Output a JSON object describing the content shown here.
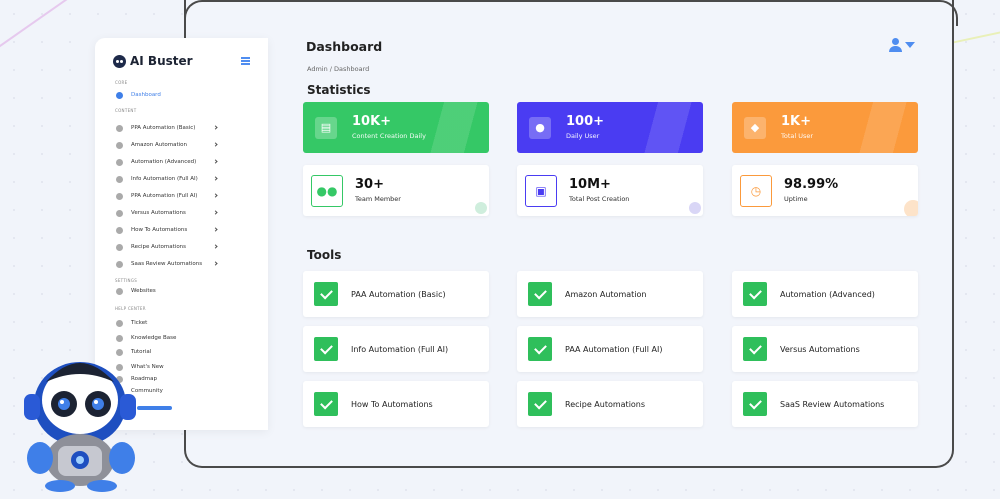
{
  "header": {
    "title": "Dashboard",
    "breadcrumb": "Admin / Dashboard"
  },
  "sidebar": {
    "brand": "AI Buster",
    "sections": {
      "core": "CORE",
      "content": "CONTENT",
      "settings": "SETTINGS",
      "help": "HELP CENTER"
    },
    "core_items": [
      {
        "label": "Dashboard"
      }
    ],
    "content_items": [
      {
        "label": "PPA Automation (Basic)"
      },
      {
        "label": "Amazon Automation"
      },
      {
        "label": "Automation (Advanced)"
      },
      {
        "label": "Info Automation (Full AI)"
      },
      {
        "label": "PPA Automation (Full AI)"
      },
      {
        "label": "Versus Automations"
      },
      {
        "label": "How To Automations"
      },
      {
        "label": "Recipe Automations"
      },
      {
        "label": "Saas Review Automations"
      }
    ],
    "settings_items": [
      {
        "label": "Websites"
      }
    ],
    "help_items": [
      {
        "label": "Ticket"
      },
      {
        "label": "Knowledge Base"
      },
      {
        "label": "Tutorial"
      },
      {
        "label": "What's New"
      },
      {
        "label": "Roadmap"
      },
      {
        "label": "Community"
      }
    ]
  },
  "statistics": {
    "title": "Statistics",
    "cards": [
      {
        "value": "10K+",
        "label": "Content Creation Daily",
        "color": "#35c866"
      },
      {
        "value": "100+",
        "label": "Daily User",
        "color": "#4a3cf2"
      },
      {
        "value": "1K+",
        "label": "Total User",
        "color": "#fb9a3c"
      },
      {
        "value": "30+",
        "label": "Team Member",
        "color": "#35c866"
      },
      {
        "value": "10M+",
        "label": "Total Post Creation",
        "color": "#4a3cf2"
      },
      {
        "value": "98.99%",
        "label": "Uptime",
        "color": "#fb9a3c"
      }
    ]
  },
  "tools": {
    "title": "Tools",
    "items": [
      {
        "label": "PAA Automation (Basic)"
      },
      {
        "label": "Amazon Automation"
      },
      {
        "label": "Automation (Advanced)"
      },
      {
        "label": "Info Automation (Full AI)"
      },
      {
        "label": "PAA Automation (Full AI)"
      },
      {
        "label": "Versus Automations"
      },
      {
        "label": "How To Automations"
      },
      {
        "label": "Recipe Automations"
      },
      {
        "label": "SaaS Review Automations"
      }
    ]
  }
}
